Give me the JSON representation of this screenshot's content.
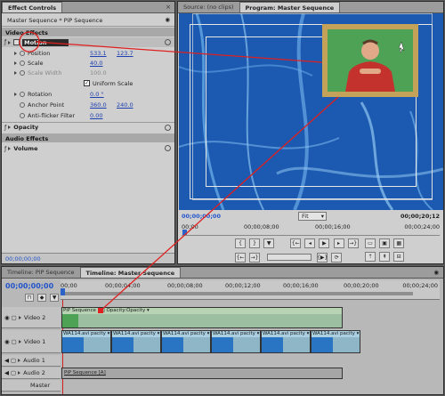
{
  "effect_controls": {
    "tab": "Effect Controls",
    "close_glyph": "×",
    "menu_glyph": "◉",
    "breadcrumb": "Master Sequence * PiP Sequence",
    "video_effects_header": "Video Effects",
    "motion": {
      "label": "Motion"
    },
    "rows": [
      {
        "label": "Position",
        "v1": "533.1",
        "v2": "123.7"
      },
      {
        "label": "Scale",
        "v1": "40.0"
      },
      {
        "label": "Scale Width",
        "v1": "100.0"
      },
      {
        "label": "Uniform Scale"
      },
      {
        "label": "Rotation",
        "v1": "0.0 °"
      },
      {
        "label": "Anchor Point",
        "v1": "360.0",
        "v2": "240.0"
      },
      {
        "label": "Anti-flicker Filter",
        "v1": "0.00"
      }
    ],
    "opacity": "Opacity",
    "audio_effects_header": "Audio Effects",
    "volume": "Volume",
    "timecode": "00;00;00;00"
  },
  "program_monitor": {
    "tab_source": "Source: (no clips)",
    "tab_program": "Program: Master Sequence",
    "timecode_left": "00;00;00;00",
    "fit_label": "Fit",
    "timecode_right": "00;00;20;12",
    "ruler": [
      "00;00",
      "00;00;08;00",
      "00;00;16;00",
      "00;00;24;00"
    ]
  },
  "timeline": {
    "tab_pip": "Timeline: PiP Sequence",
    "tab_master": "Timeline: Master Sequence",
    "timecode": "00;00;00;00",
    "ruler": [
      "00;00",
      "00;00;04;00",
      "00;00;08;00",
      "00;00;12;00",
      "00;00;16;00",
      "00;00;20;00",
      "00;00;24;00"
    ],
    "tracks": {
      "video2": "Video 2",
      "video1": "Video 1",
      "audio1": "Audio 1",
      "audio2": "Audio 2",
      "master": "Master"
    },
    "pip_clip_label": "PiP Sequence [V]  Opacity:Opacity ▾",
    "video_clips": [
      "WA114.avi pacity ▾",
      "WA114.avi pacity ▾",
      "WA114.avi pacity ▾",
      "WA114.avi pacity ▾",
      "WA114.avi pacity ▾",
      "WA114.avi pacity ▾"
    ],
    "audio_clip_label": "PiP Sequence [A]"
  },
  "colors": {
    "accent_red": "#e02020",
    "water_blue": "#1c5fb5",
    "clip_blue": "#8fb6c7"
  }
}
